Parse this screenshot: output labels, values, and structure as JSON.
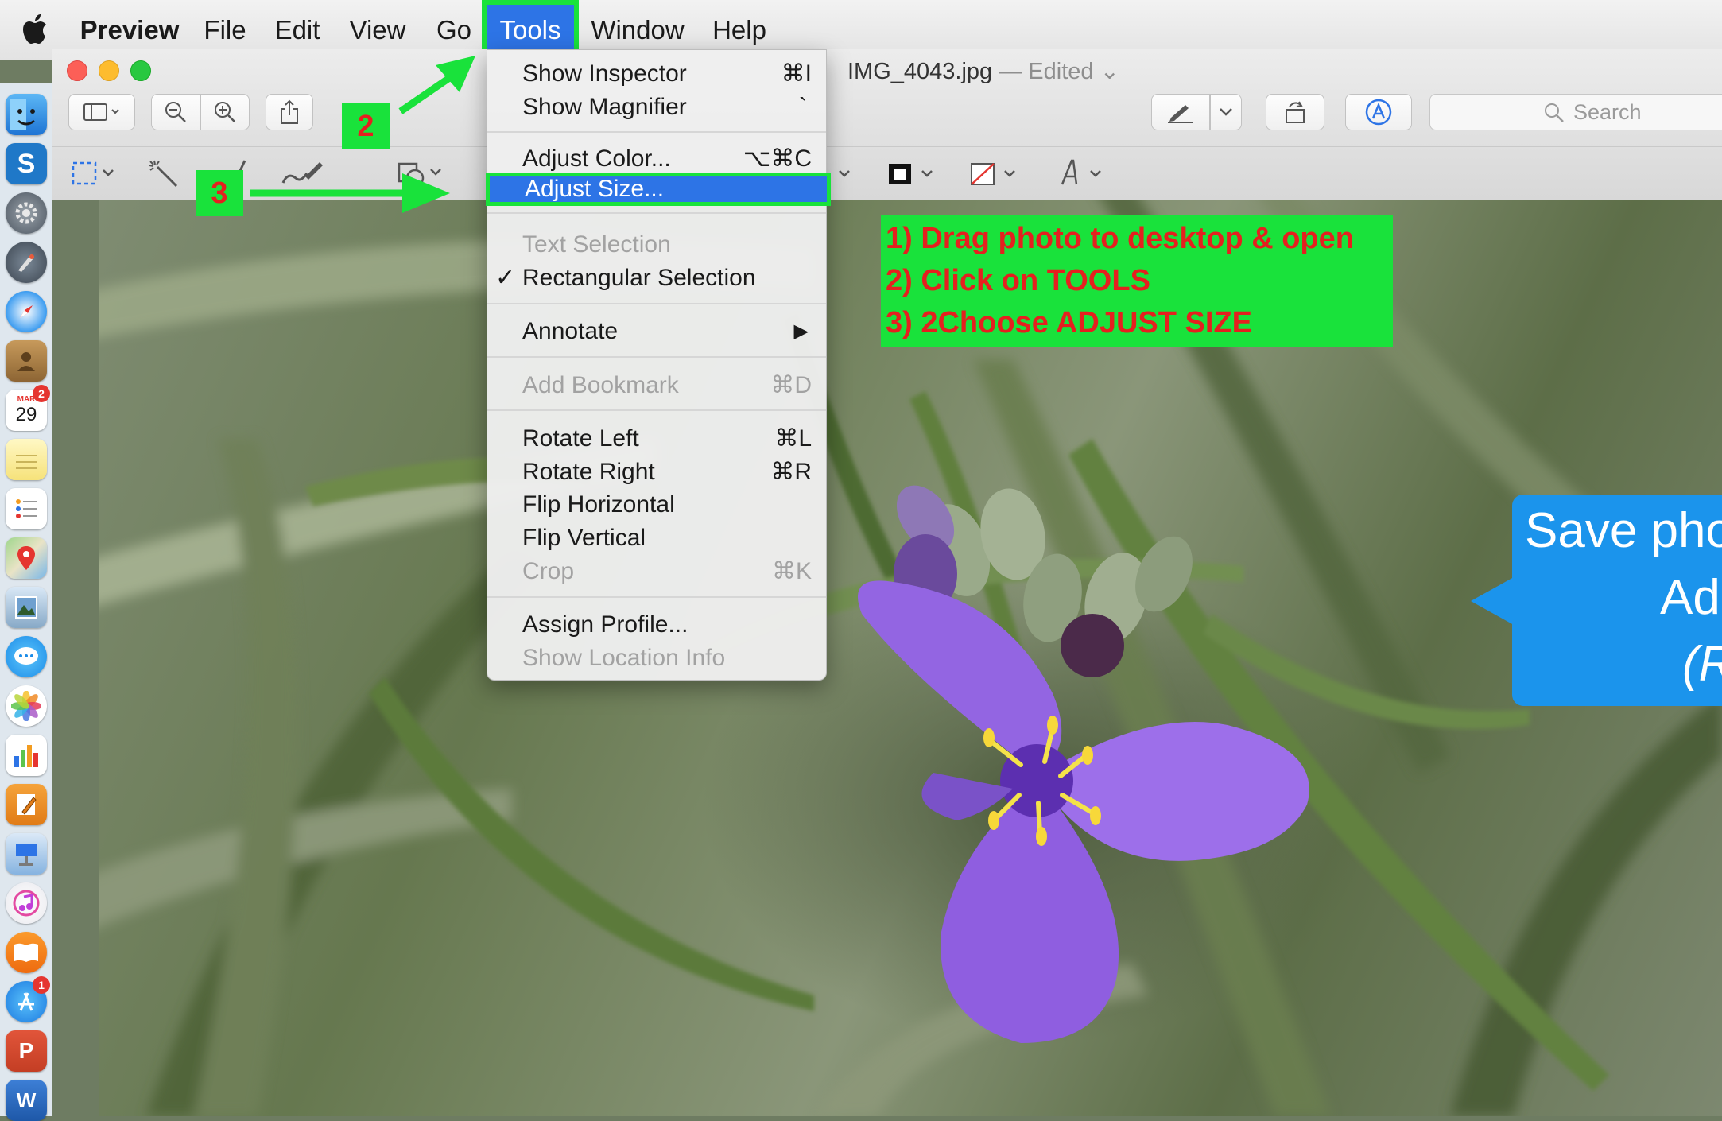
{
  "menubar": {
    "app_name": "Preview",
    "items": [
      "File",
      "Edit",
      "View",
      "Go",
      "Tools",
      "Window",
      "Help"
    ]
  },
  "dock": {
    "calendar_month": "MAR",
    "calendar_day": "29",
    "calendar_badge": "2",
    "appstore_badge": "1",
    "skype_letter": "S",
    "powerpoint_letter": "P",
    "word_letter": "W"
  },
  "window": {
    "filename": "IMG_4043.jpg",
    "edited_label": "— Edited",
    "search_placeholder": "Search"
  },
  "tools_menu": {
    "show_inspector": "Show Inspector",
    "show_inspector_shortcut": "⌘I",
    "show_magnifier": "Show Magnifier",
    "show_magnifier_shortcut": "`",
    "adjust_color": "Adjust Color...",
    "adjust_color_shortcut": "⌥⌘C",
    "adjust_size": "Adjust Size...",
    "text_selection": "Text Selection",
    "rectangular_selection": "Rectangular Selection",
    "checkmark": "✓",
    "annotate": "Annotate",
    "add_bookmark": "Add Bookmark",
    "add_bookmark_shortcut": "⌘D",
    "rotate_left": "Rotate Left",
    "rotate_left_shortcut": "⌘L",
    "rotate_right": "Rotate Right",
    "rotate_right_shortcut": "⌘R",
    "flip_horizontal": "Flip Horizontal",
    "flip_vertical": "Flip Vertical",
    "crop": "Crop",
    "crop_shortcut": "⌘K",
    "assign_profile": "Assign Profile...",
    "show_location_info": "Show Location Info"
  },
  "annotations": {
    "step2": "2",
    "step3": "3",
    "instructions": [
      "1) Drag  photo to desktop & open",
      "2) Click on TOOLS",
      "3) 2Choose ADJUST SIZE"
    ],
    "callout_lines": [
      "Save pho",
      "Ad",
      "(R"
    ]
  },
  "colors": {
    "highlight_green": "#19e23b",
    "annotation_red": "#e5201f",
    "menu_selection_blue": "#2d74e6",
    "callout_blue": "#1b94ec"
  }
}
